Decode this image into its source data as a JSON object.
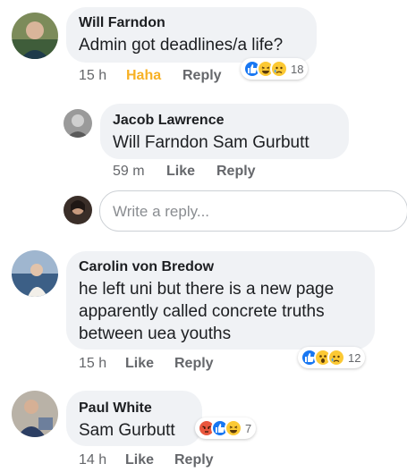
{
  "comments": [
    {
      "author": "Will Farndon",
      "text": "Admin got deadlines/a life?",
      "time": "15 h",
      "reaction_label": "Haha",
      "reply_label": "Reply",
      "reactions": [
        "like",
        "haha",
        "sad"
      ],
      "reaction_count": "18"
    },
    {
      "author": "Jacob Lawrence",
      "text": "Will Farndon Sam Gurbutt",
      "time": "59 m",
      "like_label": "Like",
      "reply_label": "Reply"
    },
    {
      "author": "Carolin von Bredow",
      "text_lines": [
        "he left uni but there is a new page",
        "apparently called concrete truths",
        "between uea youths"
      ],
      "time": "15 h",
      "like_label": "Like",
      "reply_label": "Reply",
      "reactions": [
        "like",
        "wow",
        "sad"
      ],
      "reaction_count": "12"
    },
    {
      "author": "Paul White",
      "text": "Sam Gurbutt",
      "time": "14 h",
      "like_label": "Like",
      "reply_label": "Reply",
      "reactions": [
        "angry",
        "like",
        "haha"
      ],
      "reaction_count": "7"
    }
  ],
  "reply_box": {
    "placeholder": "Write a reply..."
  },
  "colors": {
    "bubble": "#f0f2f5",
    "meta_text": "#65676b",
    "haha_active": "#f7b125",
    "like_blue": "#1877f2",
    "emoji_yellow": "#fcc934",
    "angry_red": "#e9573e"
  }
}
